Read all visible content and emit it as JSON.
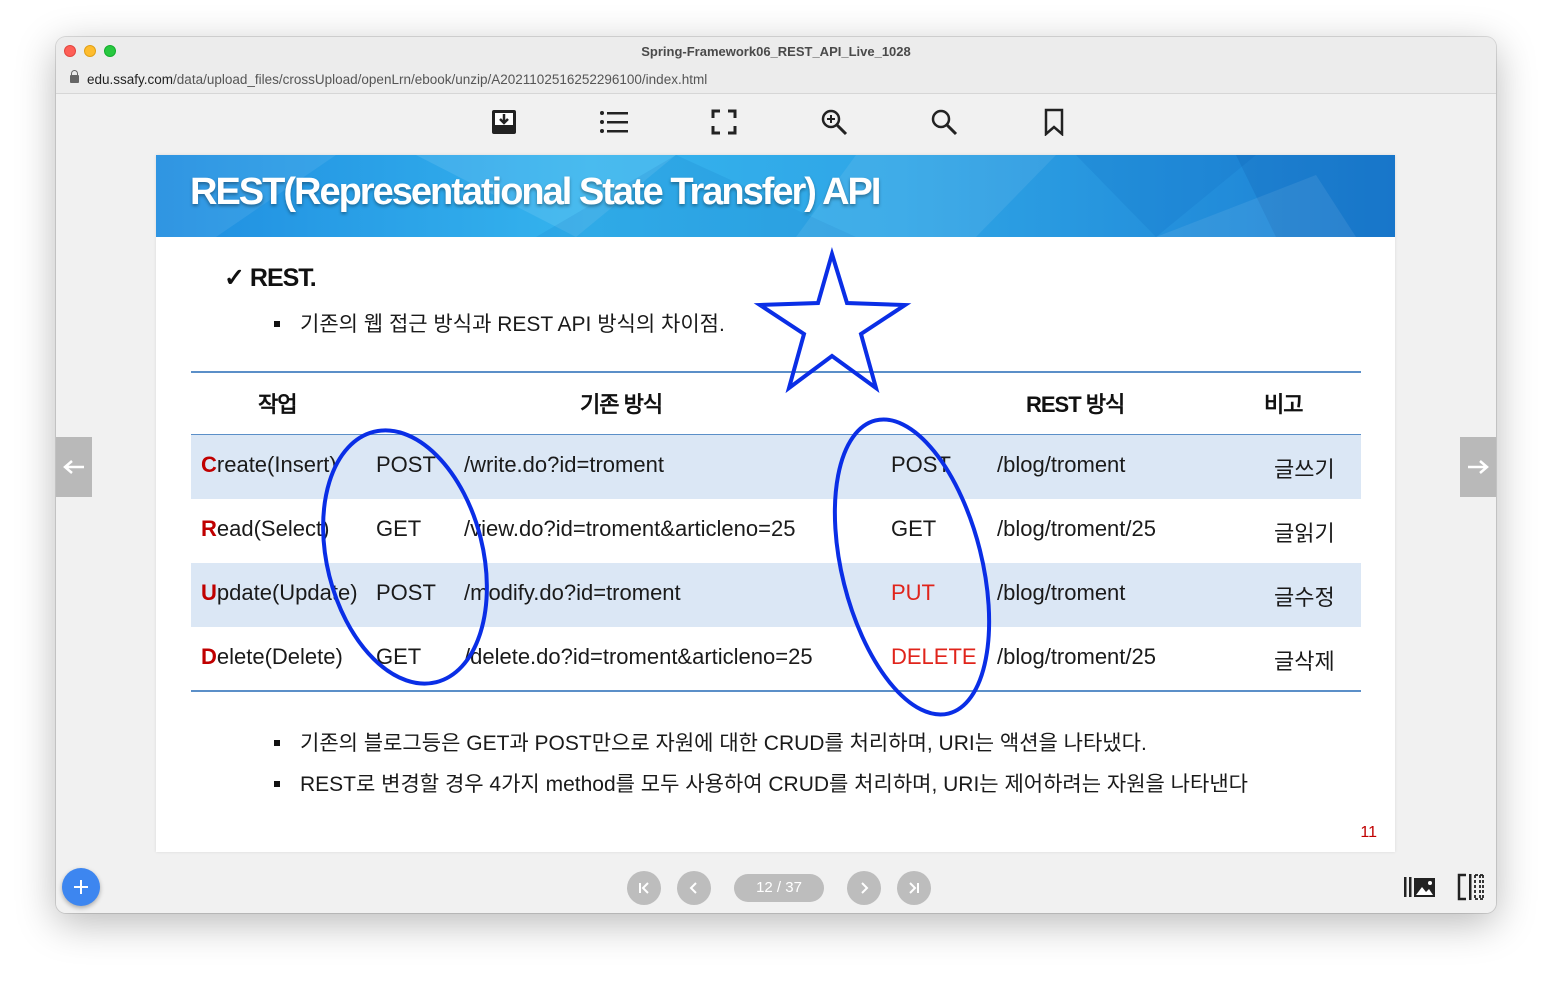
{
  "window": {
    "title": "Spring-Framework06_REST_API_Live_1028",
    "url_domain": "edu.ssafy.com",
    "url_path": "/data/upload_files/crossUpload/openLrn/ebook/unzip/A2021102516252296100/index.html"
  },
  "toolbar": {
    "icons": [
      "download-icon",
      "list-icon",
      "fullscreen-icon",
      "zoom-in-icon",
      "search-icon",
      "bookmark-icon"
    ]
  },
  "slide": {
    "title": "REST(Representational State Transfer) API",
    "check_mark": "✓",
    "heading": "REST.",
    "intro": "기존의 웹 접근 방식과 REST API 방식의 차이점.",
    "table": {
      "headers": {
        "task": "작업",
        "old": "기존 방식",
        "rest": "REST 방식",
        "note": "비고"
      },
      "rows": [
        {
          "op_first": "C",
          "op_rest": "reate(Insert)",
          "old_method": "POST",
          "old_uri": "/write.do?id=troment",
          "rest_method": "POST",
          "rest_uri": "/blog/troment",
          "note": "글쓰기"
        },
        {
          "op_first": "R",
          "op_rest": "ead(Select)",
          "old_method": "GET",
          "old_uri": "/view.do?id=troment&articleno=25",
          "rest_method": "GET",
          "rest_uri": "/blog/troment/25",
          "note": "글읽기"
        },
        {
          "op_first": "U",
          "op_rest": "pdate(Update)",
          "old_method": "POST",
          "old_uri": "/modify.do?id=troment",
          "rest_method": "PUT",
          "rest_uri": "/blog/troment",
          "note": "글수정"
        },
        {
          "op_first": "D",
          "op_rest": "elete(Delete)",
          "old_method": "GET",
          "old_uri": "/delete.do?id=troment&articleno=25",
          "rest_method": "DELETE",
          "rest_uri": "/blog/troment/25",
          "note": "글삭제"
        }
      ]
    },
    "notes": [
      "기존의 블로그등은 GET과 POST만으로 자원에 대한 CRUD를 처리하며, URI는 액션을 나타냈다.",
      "REST로 변경할 경우 4가지 method를 모두 사용하여 CRUD를 처리하며, URI는 제어하려는 자원을 나타낸다"
    ],
    "page_number": "11"
  },
  "pagination": {
    "label": "12 / 37"
  },
  "colors": {
    "banner": "#2fa5e6",
    "accent_red": "#c00000",
    "method_red": "#e0241b",
    "annotation_blue": "#0a2ee6",
    "row_shade": "#dbe7f5"
  }
}
